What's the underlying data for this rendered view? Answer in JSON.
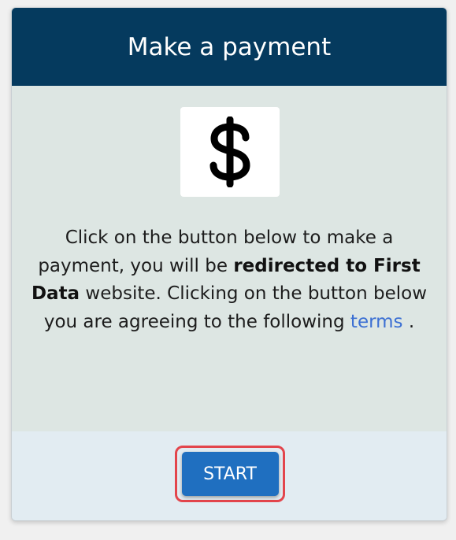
{
  "card": {
    "title": "Make a payment",
    "icon": "dollar-sign-icon",
    "text_part1": "Click on the button below to make a payment, you will be ",
    "text_bold": "redirected to First Data",
    "text_part2": " website. Clicking on the button below you are agreeing to the following ",
    "terms_link": "terms",
    "text_end": " .",
    "start_label": "START"
  },
  "colors": {
    "header_bg": "#053a5e",
    "body_bg": "#dde6e3",
    "footer_bg": "#e2ecf2",
    "button_bg": "#1f6fc0",
    "highlight_outline": "#e3454c",
    "link": "#3b6fd3"
  }
}
